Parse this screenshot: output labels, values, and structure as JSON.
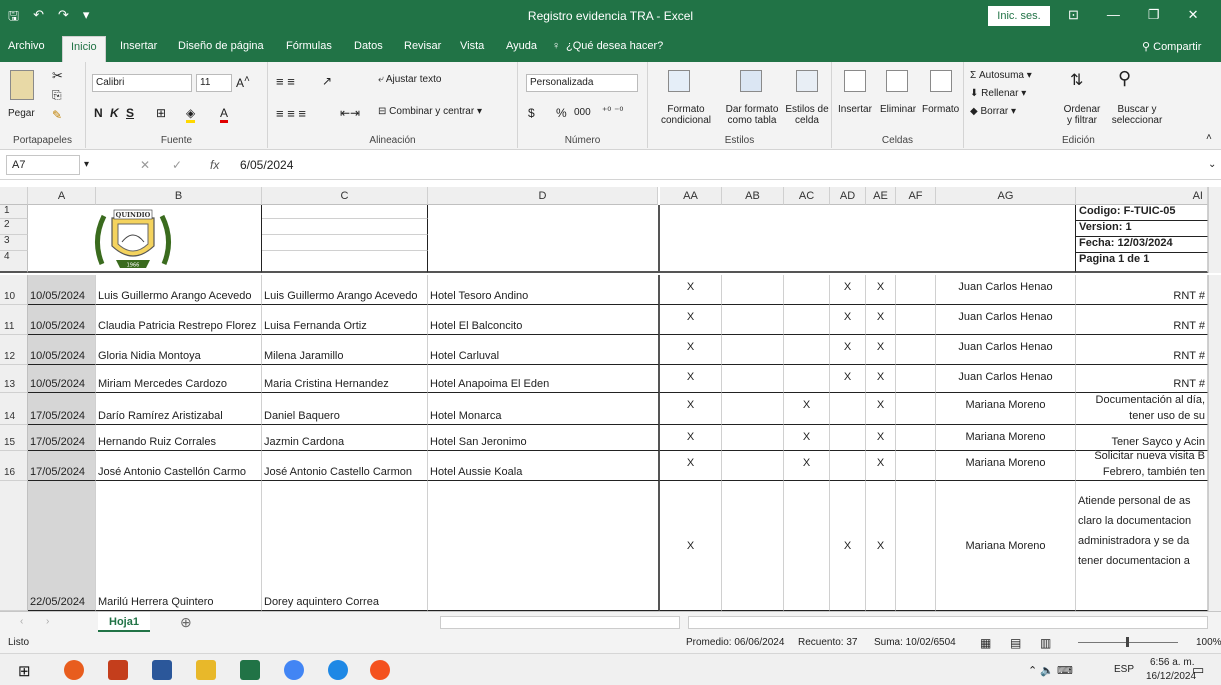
{
  "window": {
    "title": "Registro evidencia TRA  -  Excel",
    "signin_label": "Inic. ses."
  },
  "tabs": [
    "Archivo",
    "Inicio",
    "Insertar",
    "Diseño de página",
    "Fórmulas",
    "Datos",
    "Revisar",
    "Vista",
    "Ayuda"
  ],
  "tell_me": "¿Qué desea hacer?",
  "share_label": "Compartir",
  "ribbon": {
    "paste": "Pegar",
    "font_name": "Calibri",
    "font_size": "11",
    "bold": "N",
    "italic": "K",
    "underline": "S",
    "wrap_text": "Ajustar texto",
    "merge_center": "Combinar y centrar",
    "number_format": "Personalizada",
    "currency": "$",
    "percent": "%",
    "thousands": "000",
    "cond_format": "Formato condicional",
    "format_table": "Dar formato como tabla",
    "cell_styles": "Estilos de celda",
    "insert": "Insertar",
    "delete": "Eliminar",
    "format": "Formato",
    "autosum": "Autosuma",
    "fill": "Rellenar",
    "clear": "Borrar",
    "sort_filter": "Ordenar y filtrar",
    "find_select": "Buscar y seleccionar",
    "groups": [
      "Portapapeles",
      "Fuente",
      "Alineación",
      "Número",
      "Estilos",
      "Celdas",
      "Edición"
    ]
  },
  "formula_bar": {
    "name_box": "A7",
    "fx": "fx",
    "value": "6/05/2024"
  },
  "columns": [
    "A",
    "B",
    "C",
    "D",
    "AA",
    "AB",
    "AC",
    "AD",
    "AE",
    "AF",
    "AG",
    "AI"
  ],
  "header_rows": [
    "1",
    "2",
    "3",
    "4"
  ],
  "header_meta": [
    "Codigo: F-TUIC-05",
    "Version: 1",
    "Fecha: 12/03/2024",
    "Pagina 1 de 1"
  ],
  "logo_text": "QUINDIO",
  "logo_year": "1966",
  "rows": [
    {
      "num": "10",
      "a": "10/05/2024",
      "b": "Luis Guillermo Arango Acevedo",
      "c": "Luis Guillermo Arango Acevedo",
      "d": "Hotel Tesoro Andino",
      "aa": "X",
      "ab": "",
      "ac": "",
      "ad": "X",
      "ae": "X",
      "af": "",
      "ag": "Juan Carlos Henao",
      "ai": "RNT #"
    },
    {
      "num": "11",
      "a": "10/05/2024",
      "b": "Claudia Patricia Restrepo Florez",
      "c": "Luisa Fernanda Ortiz",
      "d": "Hotel El Balconcito",
      "aa": "X",
      "ab": "",
      "ac": "",
      "ad": "X",
      "ae": "X",
      "af": "",
      "ag": "Juan Carlos Henao",
      "ai": "RNT #"
    },
    {
      "num": "12",
      "a": "10/05/2024",
      "b": "Gloria Nidia Montoya",
      "c": "Milena Jaramillo",
      "d": "Hotel Carluval",
      "aa": "X",
      "ab": "",
      "ac": "",
      "ad": "X",
      "ae": "X",
      "af": "",
      "ag": "Juan Carlos Henao",
      "ai": "RNT #"
    },
    {
      "num": "13",
      "a": "10/05/2024",
      "b": "Miriam Mercedes Cardozo",
      "c": "Maria Cristina Hernandez",
      "d": "Hotel Anapoima El Eden",
      "aa": "X",
      "ab": "",
      "ac": "",
      "ad": "X",
      "ae": "X",
      "af": "",
      "ag": "Juan Carlos Henao",
      "ai": "RNT #"
    },
    {
      "num": "14",
      "a": "17/05/2024",
      "b": "Darío Ramírez Aristizabal",
      "c": "Daniel Baquero",
      "d": "Hotel Monarca",
      "aa": "X",
      "ab": "",
      "ac": "X",
      "ad": "",
      "ae": "X",
      "af": "",
      "ag": "Mariana Moreno",
      "ai": "Documentación al día, tener uso de su"
    },
    {
      "num": "15",
      "a": "17/05/2024",
      "b": "Hernando Ruiz Corrales",
      "c": "Jazmin Cardona",
      "d": "Hotel San Jeronimo",
      "aa": "X",
      "ab": "",
      "ac": "X",
      "ad": "",
      "ae": "X",
      "af": "",
      "ag": "Mariana Moreno",
      "ai": "Tener Sayco y Acin"
    },
    {
      "num": "16",
      "a": "17/05/2024",
      "b": "José Antonio Castellón Carmo",
      "c": "José Antonio Castello Carmon",
      "d": "Hotel Aussie Koala",
      "aa": "X",
      "ab": "",
      "ac": "X",
      "ad": "",
      "ae": "X",
      "af": "",
      "ag": "Mariana Moreno",
      "ai": "Solicitar nueva visita B Febrero, también ten"
    },
    {
      "num": "",
      "a": "22/05/2024",
      "b": "Marilú Herrera Quintero",
      "c": "Dorey aquintero Correa",
      "d": "",
      "aa": "X",
      "ab": "",
      "ac": "",
      "ad": "X",
      "ae": "X",
      "af": "",
      "ag": "Mariana Moreno",
      "ai": "Atiende personal de as claro la documentacion administradora y se da tener documentacion a"
    }
  ],
  "sheet_tab": "Hoja1",
  "status": {
    "ready": "Listo",
    "average": "Promedio: 06/06/2024",
    "count": "Recuento: 37",
    "sum": "Suma: 10/02/6504",
    "zoom": "100%"
  },
  "taskbar": {
    "lang": "ESP",
    "time": "6:56 a. m.",
    "date": "16/12/2024"
  },
  "colors": {
    "excel_green": "#217346"
  }
}
